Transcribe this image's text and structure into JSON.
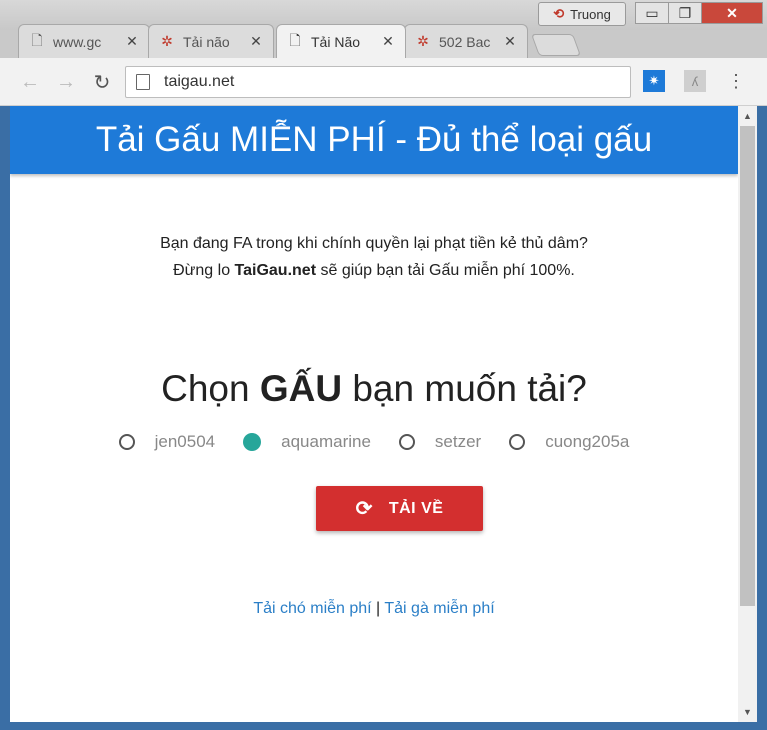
{
  "browser": {
    "tabs": [
      {
        "label": "www.gc",
        "icon": "page-icon"
      },
      {
        "label": "Tải não",
        "icon": "spinner-icon"
      },
      {
        "label": "Tải Não",
        "icon": "page-icon"
      },
      {
        "label": "502 Bac",
        "icon": "spinner-icon"
      }
    ],
    "close_glyph": "✕",
    "profile_name": "Truong",
    "address": "taigau.net",
    "window_buttons": {
      "minimize": "▭",
      "restore": "❐",
      "close": "✕"
    }
  },
  "page": {
    "header_title": "Tải Gấu MIỄN PHÍ - Đủ thể loại gấu",
    "intro_line1": "Bạn đang FA trong khi chính quyền lại phạt tiền kẻ thủ dâm?",
    "intro_line2_pre": "Đừng lo ",
    "intro_line2_brand": "TaiGau.net",
    "intro_line2_post": " sẽ giúp bạn tải Gấu miễn phí 100%.",
    "question_pre": "Chọn ",
    "question_bold": "GẤU",
    "question_post": " bạn muốn tải?",
    "options": [
      {
        "label": "jen0504",
        "selected": false
      },
      {
        "label": "aquamarine",
        "selected": true
      },
      {
        "label": "setzer",
        "selected": false
      },
      {
        "label": "cuong205a",
        "selected": false
      }
    ],
    "download_button": "TẢI VỀ",
    "link_dog": "Tải chó miễn phí",
    "link_separator": " | ",
    "link_chicken": "Tải gà miễn phí"
  },
  "colors": {
    "header": "#1e7ad8",
    "button": "#d32f2f",
    "radio_selected": "#26a69a",
    "link": "#2b7fc7"
  }
}
